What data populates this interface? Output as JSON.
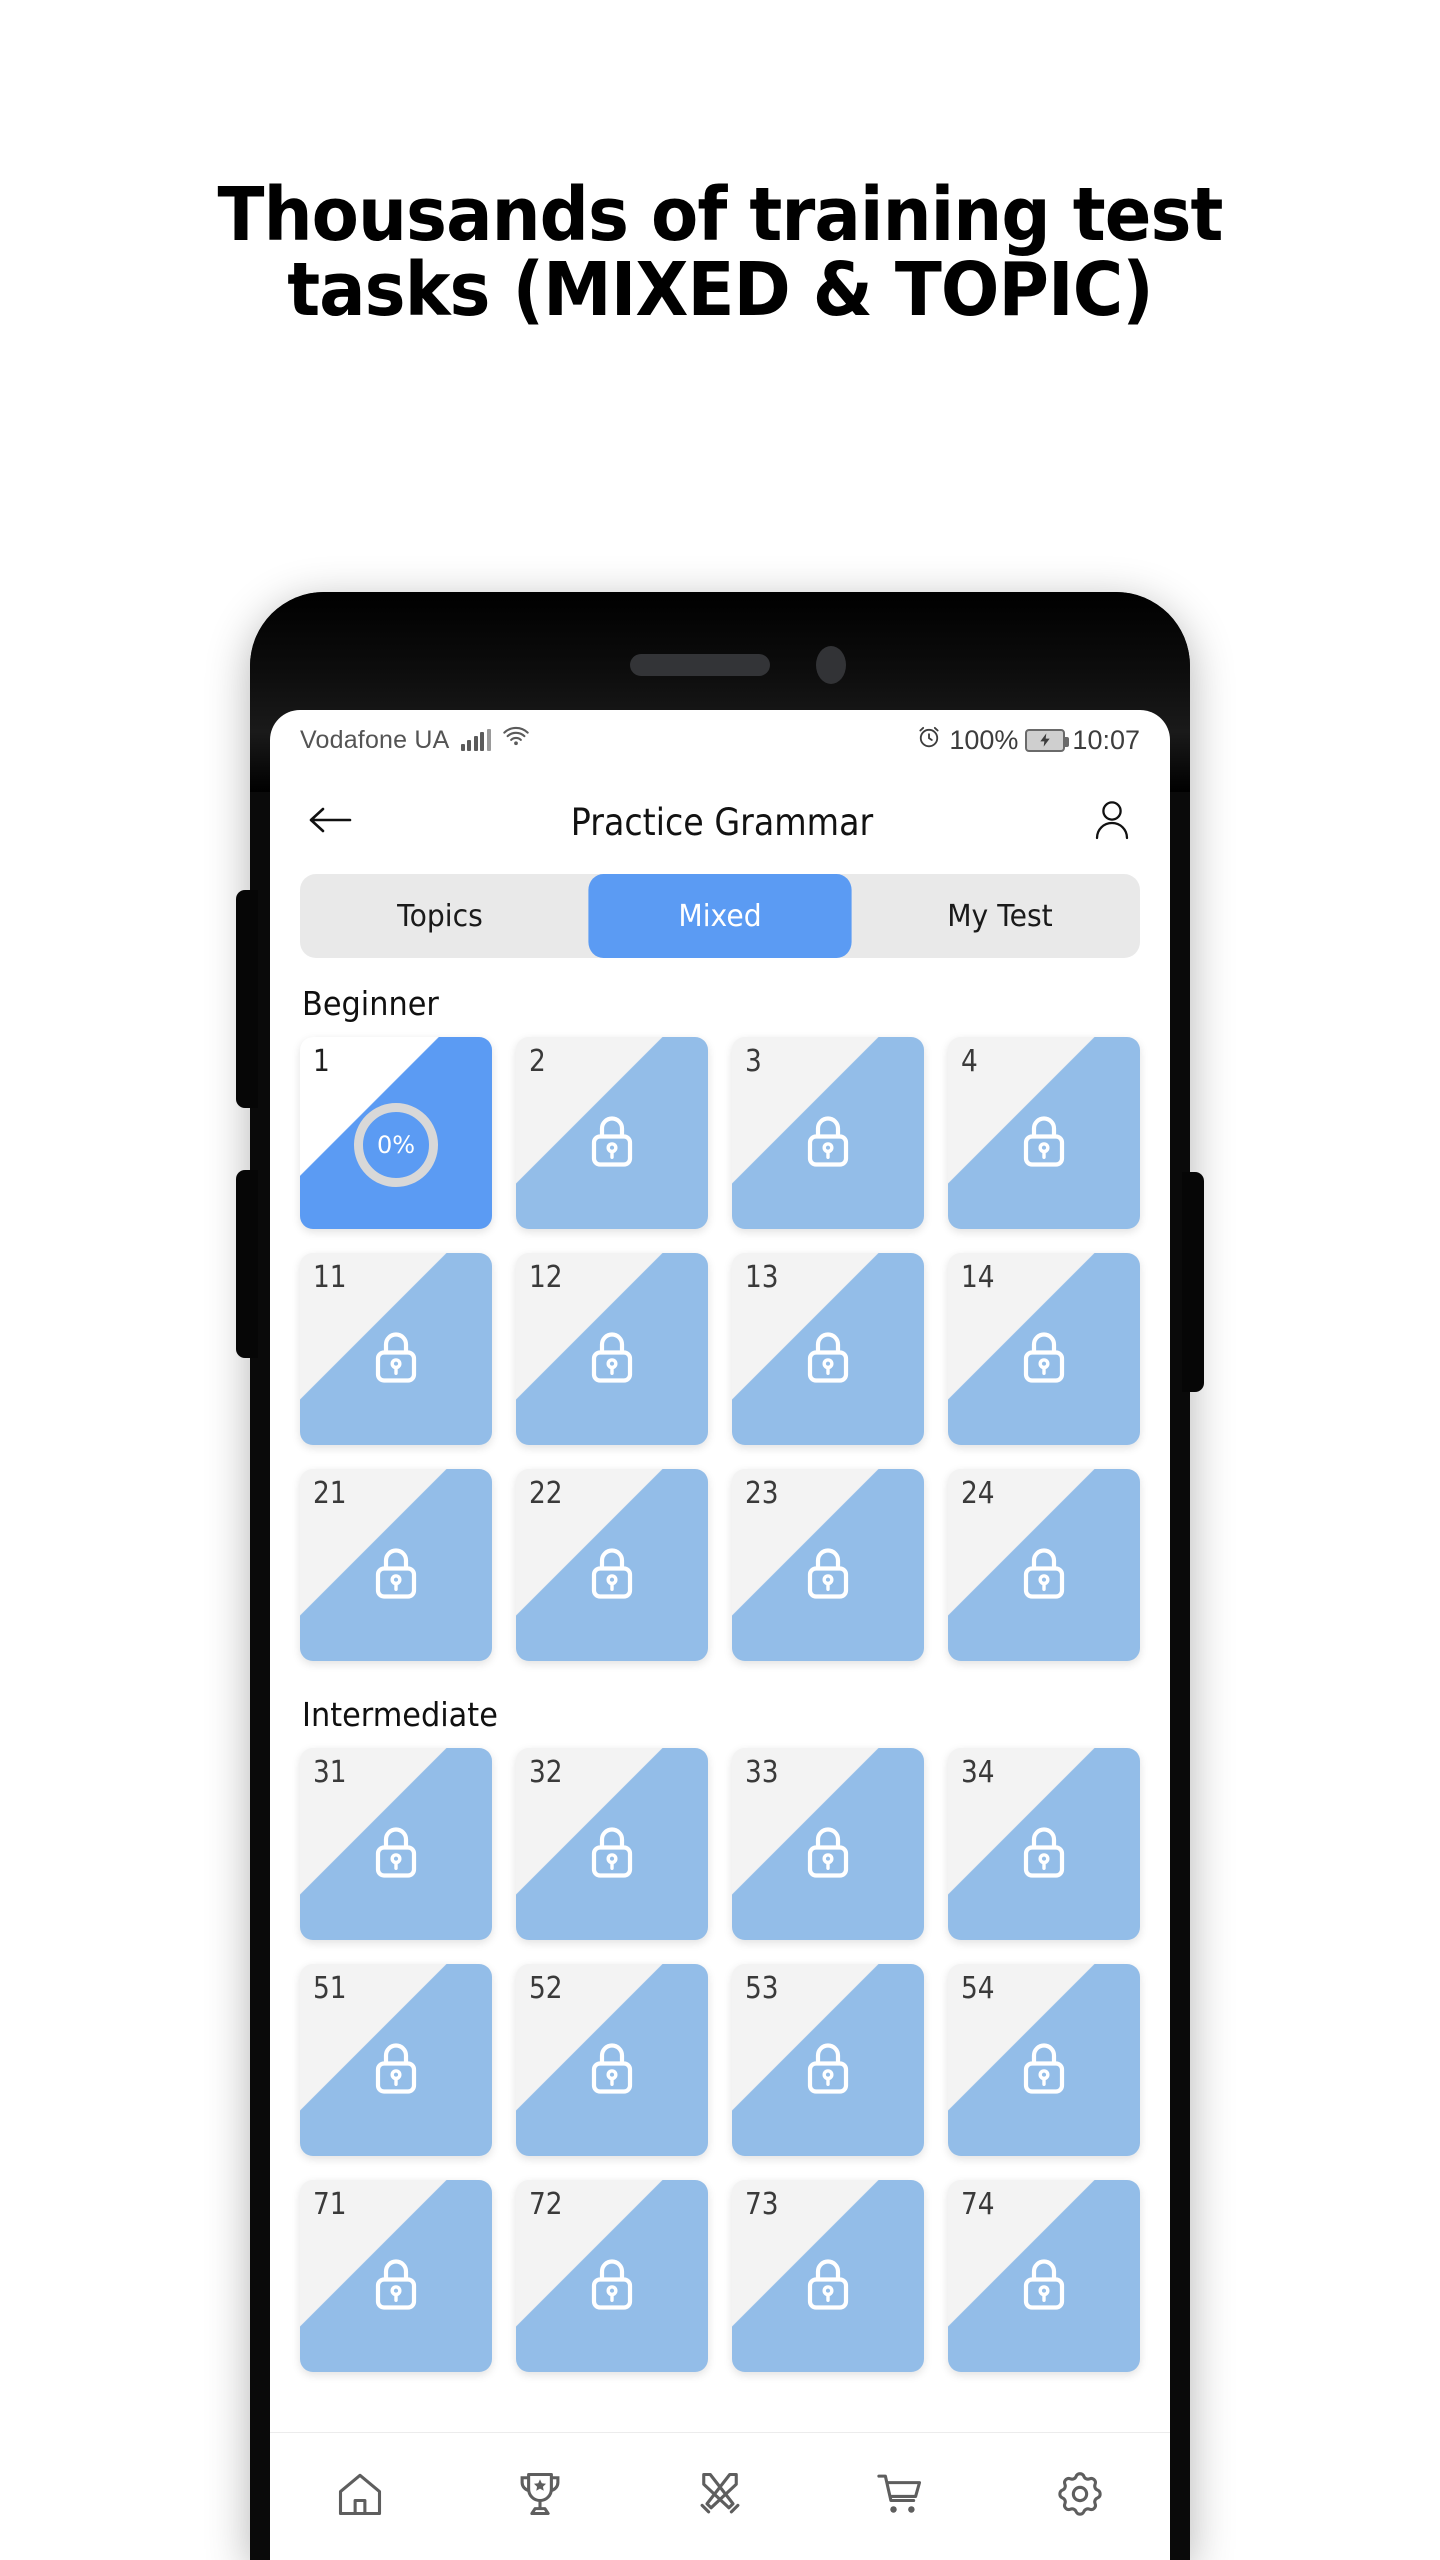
{
  "promo": {
    "headline_line1": "Thousands of training test",
    "headline_line2": "tasks (MIXED & TOPIC)"
  },
  "phone": {
    "statusbar": {
      "carrier": "Vodafone UA",
      "signal_icon": "signal-bars-icon",
      "wifi_icon": "wifi-icon",
      "alarm_icon": "alarm-clock-icon",
      "battery_percent": "100%",
      "battery_icon": "battery-charging-icon",
      "clock": "10:07"
    },
    "appbar": {
      "back_icon": "back-arrow-icon",
      "title": "Practice Grammar",
      "profile_icon": "person-icon"
    },
    "tabs": [
      {
        "label": "Topics",
        "active": false
      },
      {
        "label": "Mixed",
        "active": true
      },
      {
        "label": "My Test",
        "active": false
      }
    ],
    "sections": [
      {
        "label": "Beginner",
        "rows": [
          [
            {
              "num": "1",
              "state": "active",
              "progress": "0%"
            },
            {
              "num": "2",
              "state": "locked"
            },
            {
              "num": "3",
              "state": "locked"
            },
            {
              "num": "4",
              "state": "locked"
            }
          ],
          [
            {
              "num": "11",
              "state": "locked"
            },
            {
              "num": "12",
              "state": "locked"
            },
            {
              "num": "13",
              "state": "locked"
            },
            {
              "num": "14",
              "state": "locked"
            }
          ],
          [
            {
              "num": "21",
              "state": "locked"
            },
            {
              "num": "22",
              "state": "locked"
            },
            {
              "num": "23",
              "state": "locked"
            },
            {
              "num": "24",
              "state": "locked"
            }
          ]
        ]
      },
      {
        "label": "Intermediate",
        "rows": [
          [
            {
              "num": "31",
              "state": "locked"
            },
            {
              "num": "32",
              "state": "locked"
            },
            {
              "num": "33",
              "state": "locked"
            },
            {
              "num": "34",
              "state": "locked"
            }
          ],
          [
            {
              "num": "51",
              "state": "locked"
            },
            {
              "num": "52",
              "state": "locked"
            },
            {
              "num": "53",
              "state": "locked"
            },
            {
              "num": "54",
              "state": "locked"
            }
          ],
          [
            {
              "num": "71",
              "state": "locked"
            },
            {
              "num": "72",
              "state": "locked"
            },
            {
              "num": "73",
              "state": "locked"
            },
            {
              "num": "74",
              "state": "locked"
            }
          ]
        ]
      }
    ],
    "bottomnav": [
      {
        "icon": "home-icon"
      },
      {
        "icon": "trophy-icon"
      },
      {
        "icon": "crossed-swords-icon"
      },
      {
        "icon": "shopping-cart-icon"
      },
      {
        "icon": "settings-gear-icon"
      }
    ],
    "hardware": {
      "speaker_slot": "earpiece-speaker",
      "front_camera": "front-camera",
      "volume_up": "volume-up-button",
      "volume_down": "volume-down-button",
      "power": "power-button"
    }
  },
  "colors": {
    "accent_blue": "#5b9bf3",
    "locked_blue": "#93bde8",
    "segment_track": "#e9e9e9",
    "card_corner_locked": "#f3f3f3",
    "ring_track": "#d8d8d8",
    "text_dark": "#121212",
    "nav_icon": "#5e5e5e"
  }
}
